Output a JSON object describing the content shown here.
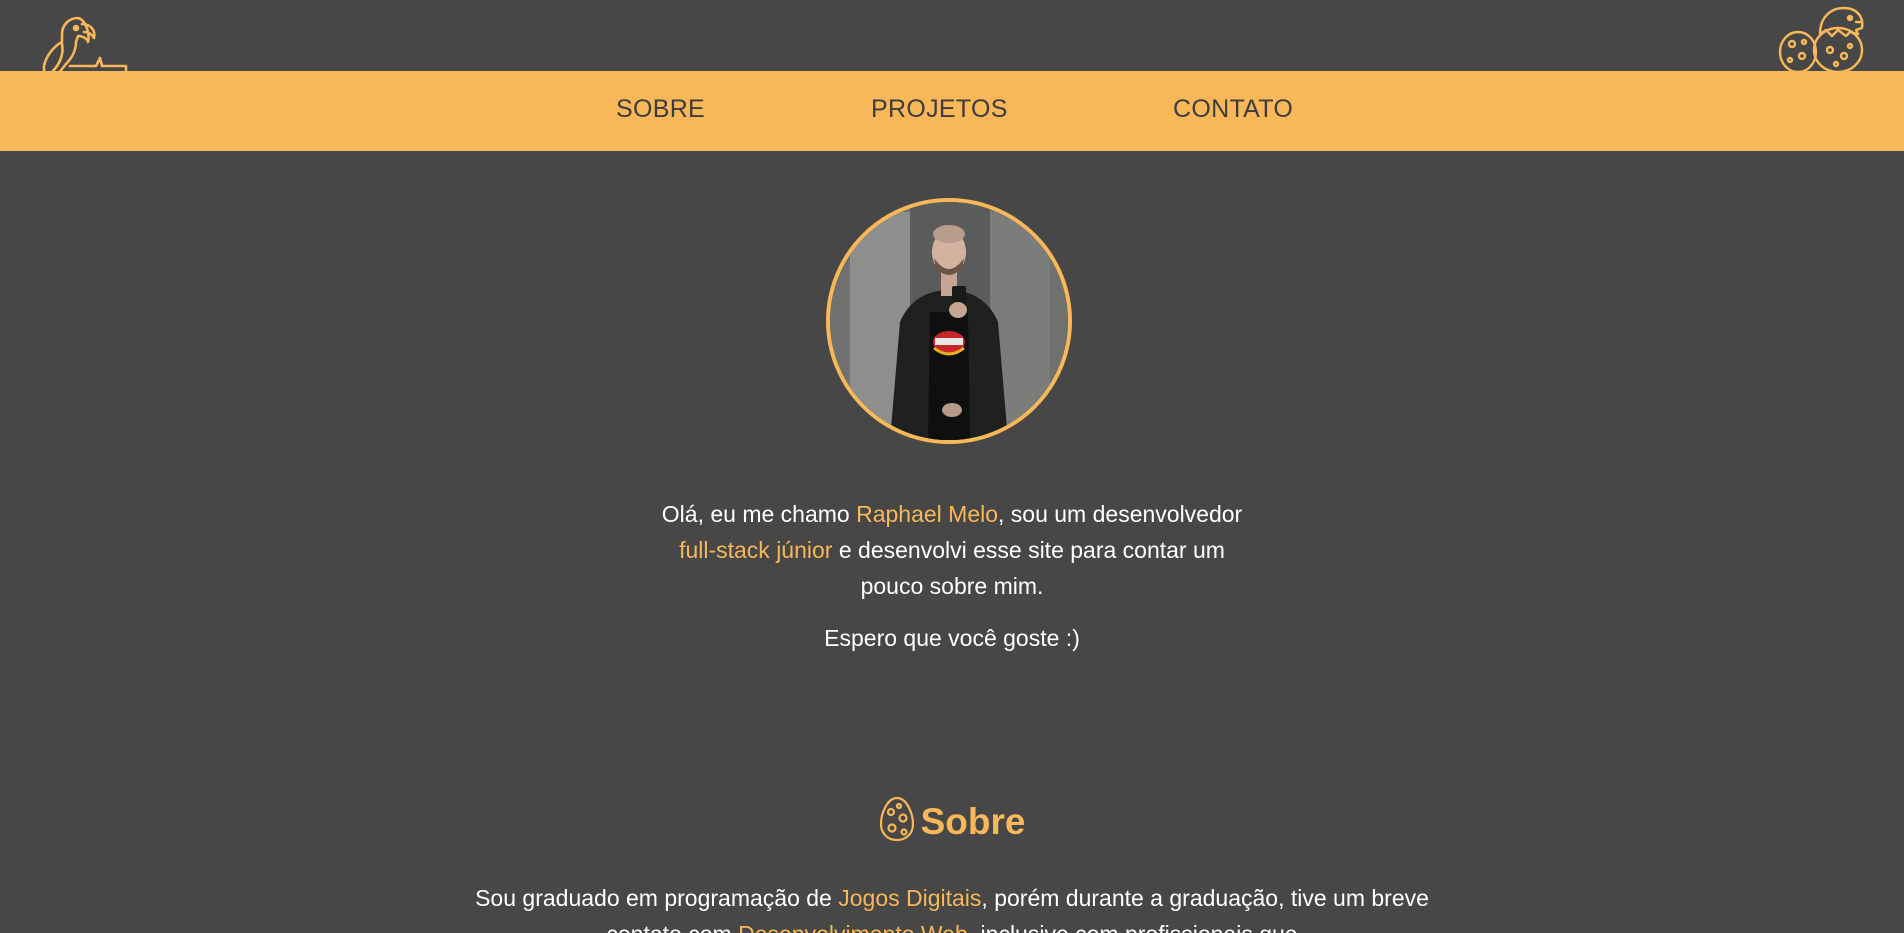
{
  "header": {
    "logo_left_icon": "parrot-icon",
    "logo_right_icon": "dinosaur-eggs-icon"
  },
  "nav": {
    "items": [
      {
        "label": "SOBRE"
      },
      {
        "label": "PROJETOS"
      },
      {
        "label": "CONTATO"
      }
    ]
  },
  "hero": {
    "avatar_icon": "profile-photo",
    "intro": {
      "part1": "Olá, eu me chamo ",
      "name": "Raphael Melo",
      "part2": ", sou um desenvolvedor ",
      "role": "full-stack júnior",
      "part3": " e desenvolvi esse site para contar um pouco sobre mim."
    },
    "closing": "Espero que você goste :)"
  },
  "about": {
    "title": "Sobre",
    "title_icon": "egg-icon",
    "text": {
      "part1": "Sou graduado em programação de ",
      "link1": "Jogos Digitais",
      "part2": ", porém durante a graduação, tive um breve contato com ",
      "link2": "Desenvolvimento Web",
      "part3": ", inclusive com profissionais que"
    }
  },
  "colors": {
    "background": "#474747",
    "accent": "#f8b758",
    "nav_text": "#3d3d3d",
    "text": "#ffffff"
  }
}
